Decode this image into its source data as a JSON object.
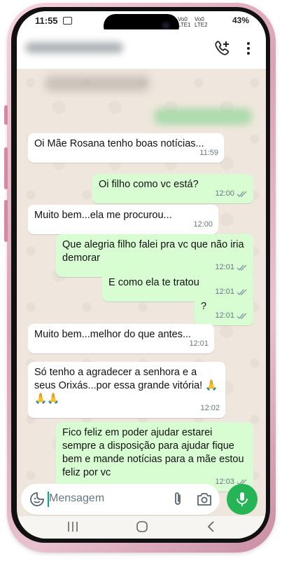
{
  "status_bar": {
    "time": "11:55",
    "battery": "43%",
    "network_top": "Vo0\nLTE1",
    "network_bottom": "Vo0\nLTE2"
  },
  "header": {
    "call_icon": "add-call-icon",
    "menu_icon": "more-vert-icon"
  },
  "messages": [
    {
      "direction": "in",
      "text": "Oi Mãe Rosana tenho boas notícias...",
      "time": "11:59"
    },
    {
      "direction": "out",
      "text": "Oi filho como vc está?",
      "time": "12:00"
    },
    {
      "direction": "in",
      "text": "Muito bem...ela me procurou...",
      "time": "12:00"
    },
    {
      "direction": "out",
      "text": "Que alegria filho falei pra vc que não iria demorar",
      "time": "12:01"
    },
    {
      "direction": "out",
      "text": "E como ela te tratou",
      "time": "12:01"
    },
    {
      "direction": "out",
      "text": "?",
      "time": "12:01"
    },
    {
      "direction": "in",
      "text": "Muito bem...melhor do que antes...",
      "time": "12:01"
    },
    {
      "direction": "in",
      "text": "Só tenho a agradecer a senhora e a seus Orixás...por essa grande vitória! 🙏🙏🙏",
      "time": "12:02"
    },
    {
      "direction": "out",
      "text": "Fico feliz em poder ajudar estarei sempre a disposição para ajudar fique bem e mande notícias para a mãe estou feliz por vc",
      "time": "12:03"
    }
  ],
  "input": {
    "placeholder": "Mensagem"
  },
  "colors": {
    "incoming": "#ffffff",
    "outgoing": "#d9fdd3",
    "accent": "#25b556",
    "chat_bg": "#efe7dd",
    "frame": "#e2b4c4"
  }
}
